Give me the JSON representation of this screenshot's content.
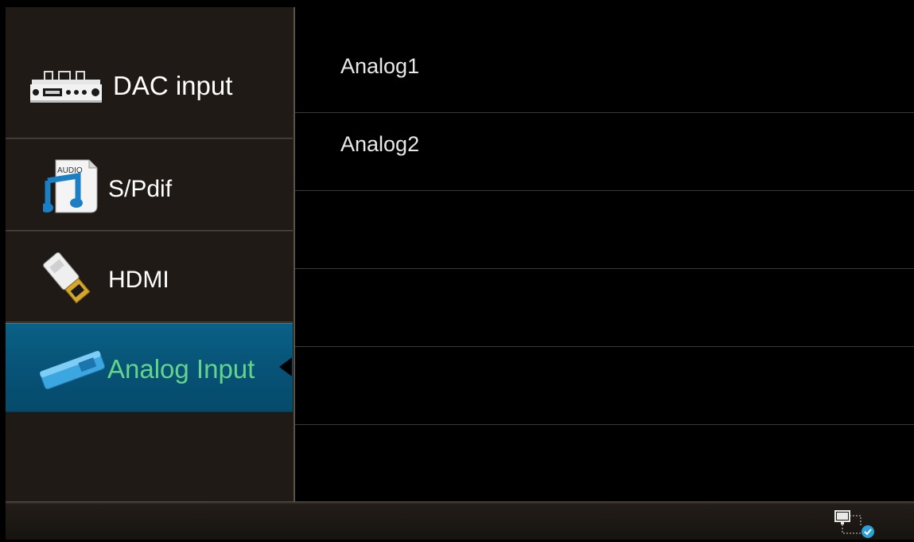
{
  "sidebar": {
    "items": [
      {
        "label": "DAC input",
        "icon": "dac-device-icon",
        "selected": false
      },
      {
        "label": "S/Pdif",
        "icon": "audio-file-icon",
        "selected": false
      },
      {
        "label": "HDMI",
        "icon": "hdmi-connector-icon",
        "selected": false
      },
      {
        "label": "Analog Input",
        "icon": "analog-input-icon",
        "selected": true
      }
    ]
  },
  "main": {
    "rows": [
      {
        "label": "Analog1"
      },
      {
        "label": "Analog2"
      },
      {
        "label": ""
      },
      {
        "label": ""
      },
      {
        "label": ""
      }
    ]
  },
  "statusbar": {
    "icon": "network-connected-icon"
  },
  "colors": {
    "sidebar_bg": "#1f1a15",
    "active_bg": "#075377",
    "active_text": "#64d48a",
    "content_bg": "#000000"
  }
}
